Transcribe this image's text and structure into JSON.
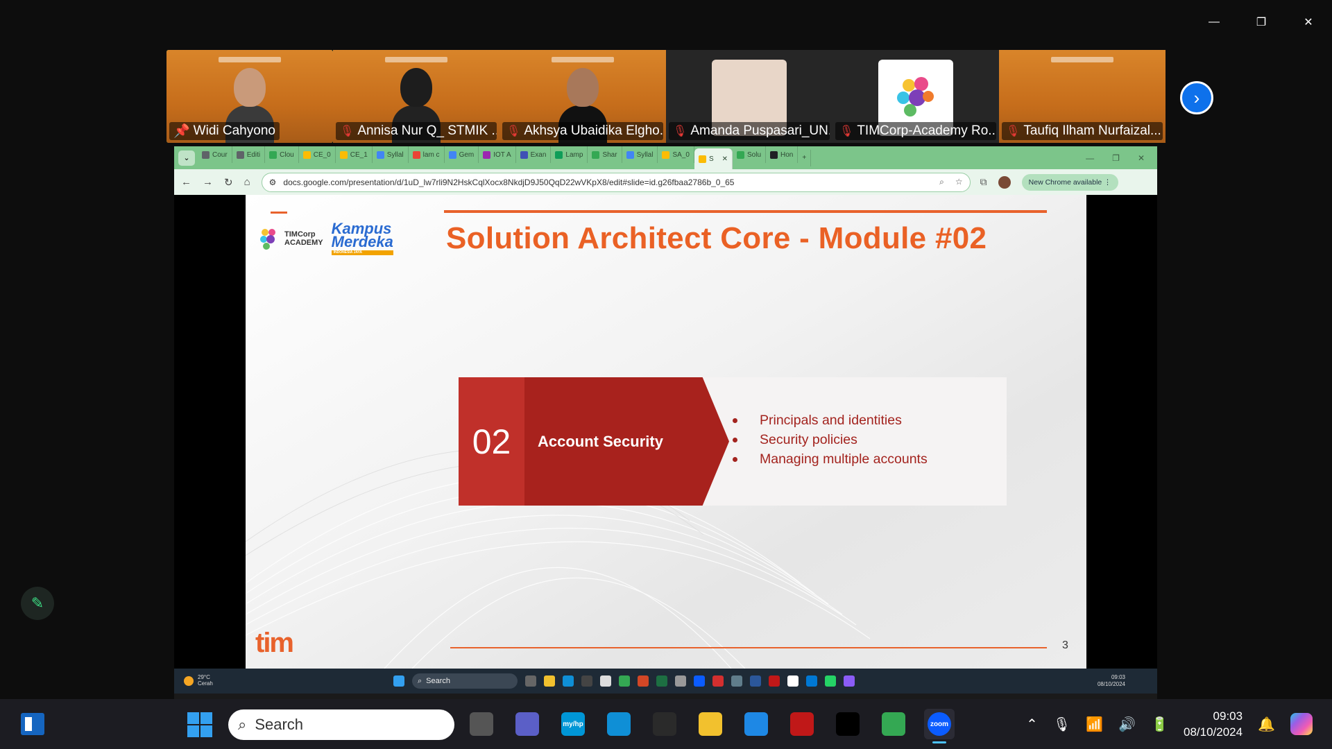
{
  "window_controls": {
    "minimize": "—",
    "restore": "❐",
    "close": "✕"
  },
  "participants": [
    {
      "name": "Widi Cahyono",
      "pinned": true,
      "muted": false,
      "active_speaker": true
    },
    {
      "name": "Annisa Nur Q_ STMIK ...",
      "muted": true
    },
    {
      "name": "Akhsya Ubaidika Elgho...",
      "muted": true
    },
    {
      "name": "Amanda Puspasari_UN...",
      "muted": true
    },
    {
      "name": "TIMCorp-Academy Ro...",
      "muted": true
    },
    {
      "name": "Taufiq Ilham Nurfaizal...",
      "muted": true
    }
  ],
  "browser": {
    "tabs": [
      {
        "label": "Cour",
        "color": "#5f6368"
      },
      {
        "label": "Editi",
        "color": "#5f6368"
      },
      {
        "label": "Clou",
        "color": "#34a853"
      },
      {
        "label": "CE_0",
        "color": "#fbbc04"
      },
      {
        "label": "CE_1",
        "color": "#fbbc04"
      },
      {
        "label": "Syllal",
        "color": "#4285f4"
      },
      {
        "label": "lam c",
        "color": "#ea4335"
      },
      {
        "label": "Gem",
        "color": "#4285f4"
      },
      {
        "label": "IOT A",
        "color": "#9c27b0"
      },
      {
        "label": "Exan",
        "color": "#3f51b5"
      },
      {
        "label": "Lamp",
        "color": "#0f9d58"
      },
      {
        "label": "Shar",
        "color": "#34a853"
      },
      {
        "label": "Syllal",
        "color": "#4285f4"
      },
      {
        "label": "SA_0",
        "color": "#fbbc04"
      },
      {
        "label": "S",
        "color": "#fbbc04",
        "active": true
      },
      {
        "label": "Solu",
        "color": "#34a853"
      },
      {
        "label": "Hon",
        "color": "#202124"
      }
    ],
    "new_tab": "+",
    "url": "docs.google.com/presentation/d/1uD_lw7rli9N2HskCqlXocx8NkdjD9J50QqD22wVKpX8/edit#slide=id.g26fbaa2786b_0_65",
    "update_label": "New Chrome available"
  },
  "slide": {
    "title": "Solution Architect Core - Module #02",
    "logo_tim": "TIMCorp",
    "logo_academy": "ACADEMY",
    "logo_kampus": "Kampus",
    "logo_merdeka": "Merdeka",
    "logo_indonesia": "INDONESIA JAYA",
    "section_number": "02",
    "section_title": "Account Security",
    "bullets": [
      "Principals and identities",
      "Security policies",
      "Managing multiple accounts"
    ],
    "page_number": "3",
    "footer_logo": "tim"
  },
  "inner_taskbar": {
    "temperature": "29°C",
    "weather": "Cerah",
    "search": "Search",
    "time": "09:03",
    "date": "08/10/2024"
  },
  "taskbar": {
    "search_placeholder": "Search",
    "time": "09:03",
    "date": "08/10/2024",
    "apps": [
      {
        "name": "task-view",
        "color": "#555"
      },
      {
        "name": "teams-meet",
        "color": "#5b5fc7"
      },
      {
        "name": "myhp",
        "label": "my/hp",
        "color": "#0096d6"
      },
      {
        "name": "edge",
        "color": "#0f8fd6"
      },
      {
        "name": "store",
        "color": "#2a2a2a"
      },
      {
        "name": "file-explorer",
        "color": "#f2c12e"
      },
      {
        "name": "help",
        "color": "#1e88e5"
      },
      {
        "name": "mcafee",
        "color": "#c01818"
      },
      {
        "name": "tiktok",
        "color": "#000"
      },
      {
        "name": "chrome",
        "color": "#34a853"
      },
      {
        "name": "zoom",
        "label": "zoom",
        "color": "#0b5cff",
        "active": true
      }
    ]
  }
}
